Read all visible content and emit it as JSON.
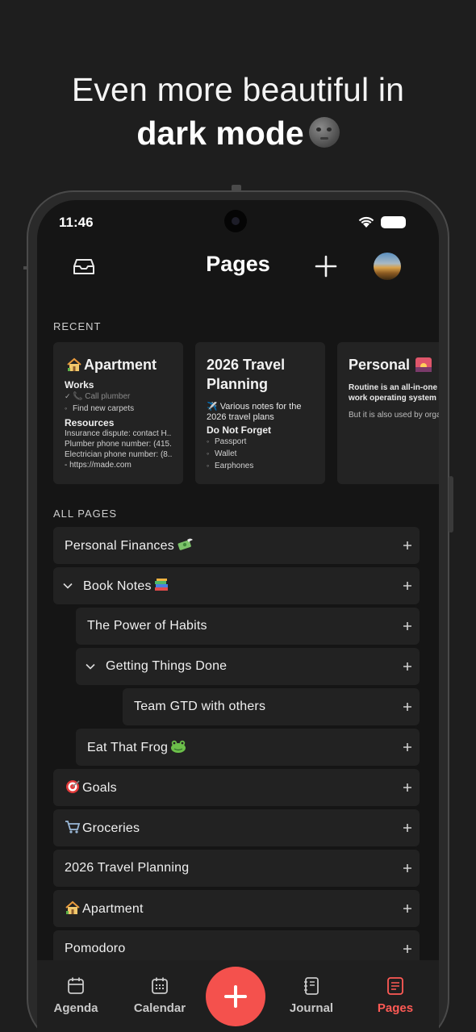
{
  "headline": {
    "line1": "Even more beautiful in",
    "line2": "dark mode"
  },
  "status_bar": {
    "time": "11:46"
  },
  "topbar": {
    "title": "Pages"
  },
  "recent": {
    "label": "RECENT",
    "cards": [
      {
        "title": "Apartment",
        "emoji": "house",
        "heading1": "Works",
        "tasks": [
          "📞 Call plumber",
          "Find new carpets"
        ],
        "heading2": "Resources",
        "lines": [
          "Insurance dispute: contact H...",
          "Plumber phone number: (415...",
          "Electrician phone number: (8...",
          "- https://made.com"
        ]
      },
      {
        "title": "2026 Travel Planning",
        "note": "✈️ Various notes for the 2026 travel plans",
        "heading": "Do Not Forget",
        "bullets": [
          "Passport",
          "Wallet",
          "Earphones"
        ]
      },
      {
        "title": "Personal",
        "emoji": "sunset",
        "line1": "Routine is an all-in-one work operating system",
        "line2": "But it is also used by orga"
      }
    ]
  },
  "all_pages": {
    "label": "ALL PAGES",
    "items": [
      {
        "label": "Personal Finances",
        "emoji": "money-with-wings",
        "expanded": false
      },
      {
        "label": "Book Notes",
        "emoji": "books",
        "expanded": true
      },
      {
        "label": "The Power of Habits",
        "emoji": "",
        "expanded": false
      },
      {
        "label": "Getting Things Done",
        "emoji": "",
        "expanded": true
      },
      {
        "label": "Team GTD with others",
        "emoji": "",
        "expanded": false
      },
      {
        "label": "Eat That Frog",
        "emoji": "frog",
        "expanded": false
      },
      {
        "label": "Goals",
        "emoji": "direct-hit",
        "expanded": false
      },
      {
        "label": "Groceries",
        "emoji": "shopping-cart",
        "expanded": false
      },
      {
        "label": "2026 Travel Planning",
        "emoji": "",
        "expanded": false
      },
      {
        "label": "Apartment",
        "emoji": "house",
        "expanded": false
      },
      {
        "label": "Pomodoro",
        "emoji": "",
        "expanded": false
      }
    ]
  },
  "bottom_nav": {
    "items": [
      {
        "label": "Agenda",
        "icon": "agenda-icon",
        "active": false
      },
      {
        "label": "Calendar",
        "icon": "calendar-icon",
        "active": false
      },
      {
        "label": "Journal",
        "icon": "journal-icon",
        "active": false
      },
      {
        "label": "Pages",
        "icon": "pages-icon",
        "active": true
      }
    ],
    "fab_icon": "plus-icon"
  },
  "colors": {
    "accent": "#f4514d",
    "background": "#151515",
    "row": "#222222"
  }
}
